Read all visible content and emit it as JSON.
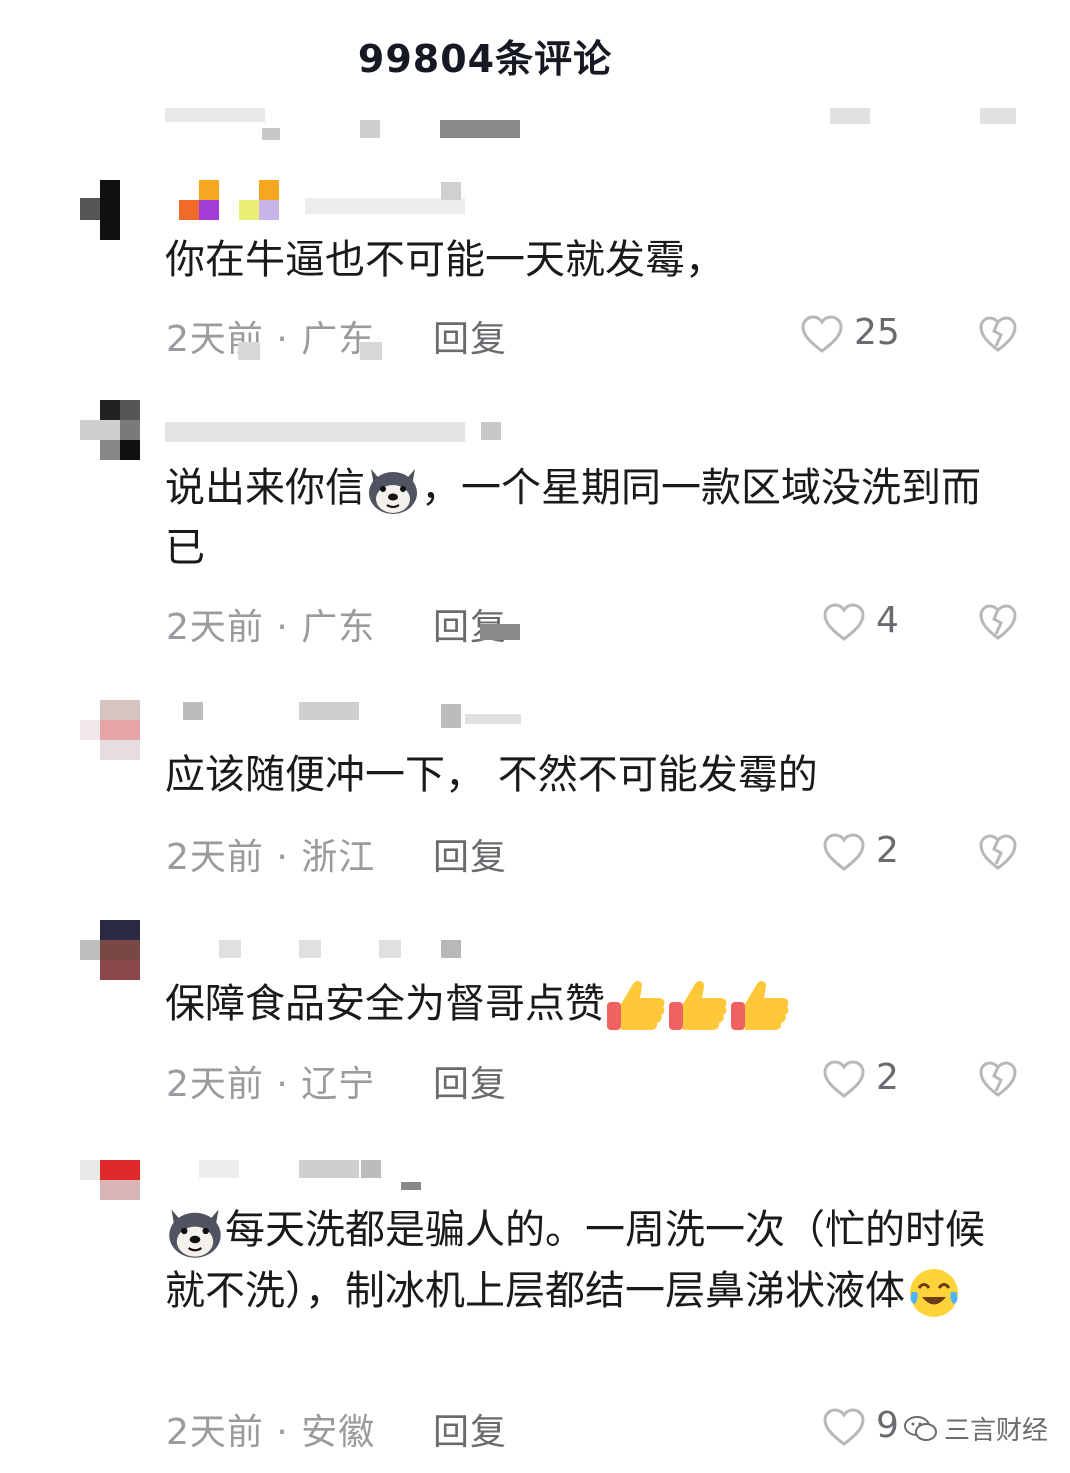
{
  "header": {
    "title": "99804条评论"
  },
  "comments": [
    {
      "text": "你在牛逼也不可能一天就发霉，",
      "time_location": "2天前 · 广东",
      "reply_label": "回复",
      "likes": "25"
    },
    {
      "text_before_emoji": "说出来你信",
      "text_after_emoji": "，一个星期同一款区域没洗到而已",
      "time_location": "2天前 · 广东",
      "reply_label": "回复",
      "likes": "4"
    },
    {
      "text": "应该随便冲一下， 不然不可能发霉的",
      "time_location": "2天前 · 浙江",
      "reply_label": "回复",
      "likes": "2"
    },
    {
      "text": "保障食品安全为督哥点赞",
      "time_location": "2天前 · 辽宁",
      "reply_label": "回复",
      "likes": "2"
    },
    {
      "text": "每天洗都是骗人的。一周洗一次（忙的时候就不洗），制冰机上层都结一层鼻涕状液体",
      "time_location": "2天前 · 安徽",
      "reply_label": "回复",
      "likes": "9"
    }
  ],
  "watermark": {
    "label": "三言财经"
  },
  "icons": {
    "like": "heart-outline-icon",
    "dislike": "broken-heart-icon",
    "dog_emoji": "husky-dog-emoji-icon",
    "thumbs_up": "thumbs-up-emoji-icon",
    "crying_laugh": "tears-of-joy-emoji-icon",
    "wechat": "wechat-logo-icon"
  },
  "colors": {
    "text": "#1a1a1a",
    "meta": "#9a9a9f",
    "icon": "#b8b8bc"
  }
}
